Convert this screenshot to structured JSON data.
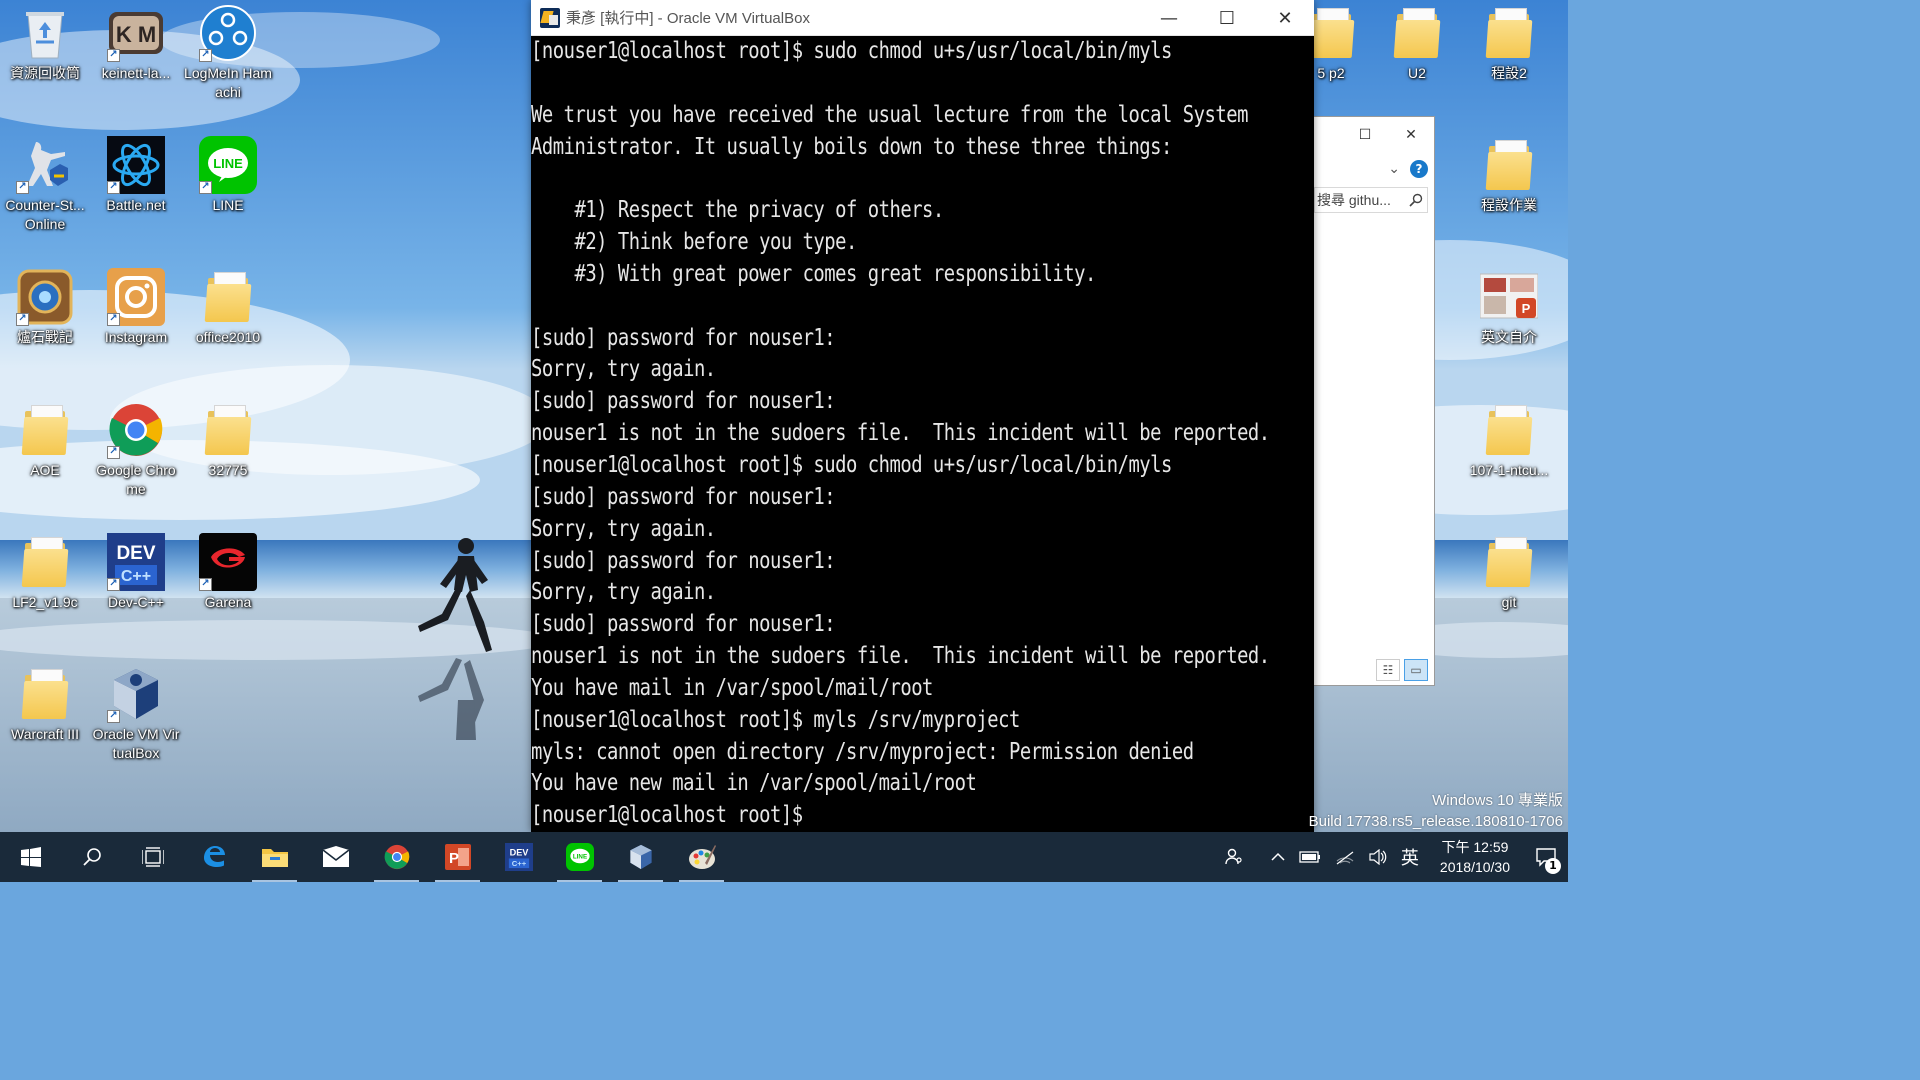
{
  "colors": {
    "terminal_bg": "#000000",
    "terminal_fg": "#e6e6e6",
    "taskbar_bg": "#1a2a3a",
    "sky_top": "#3a7fd0",
    "sea": "#2f6fb4"
  },
  "desktop": {
    "left_icons": [
      {
        "label": "資源回收筒",
        "icon": "recycle-bin-icon"
      },
      {
        "label": "keinett-la...",
        "icon": "keinett-launcher-icon"
      },
      {
        "label": "LogMeIn Hamachi",
        "icon": "hamachi-icon"
      },
      {
        "label": "Counter-St... Online",
        "icon": "counter-strike-icon"
      },
      {
        "label": "Battle.net",
        "icon": "battlenet-icon"
      },
      {
        "label": "LINE",
        "icon": "line-icon"
      },
      {
        "label": "爐石戰記",
        "icon": "hearthstone-icon"
      },
      {
        "label": "Instagram",
        "icon": "instagram-icon"
      },
      {
        "label": "office2010",
        "icon": "folder-icon"
      },
      {
        "label": "AOE",
        "icon": "folder-icon"
      },
      {
        "label": "Google Chrome",
        "icon": "chrome-icon"
      },
      {
        "label": "32775",
        "icon": "folder-icon"
      },
      {
        "label": "LF2_v1.9c",
        "icon": "folder-icon"
      },
      {
        "label": "Dev-C++",
        "icon": "devcpp-icon"
      },
      {
        "label": "Garena",
        "icon": "garena-icon"
      },
      {
        "label": "Warcraft III",
        "icon": "folder-icon"
      },
      {
        "label": "Oracle VM VirtualBox",
        "icon": "virtualbox-icon"
      }
    ],
    "right_icons": [
      {
        "label": "5 p2",
        "icon": "folder-icon"
      },
      {
        "label": "U2",
        "icon": "folder-icon"
      },
      {
        "label": "程設2",
        "icon": "folder-icon"
      },
      {
        "label": "程設作業",
        "icon": "folder-icon"
      },
      {
        "label": "英文自介",
        "icon": "powerpoint-file-icon"
      },
      {
        "label": "107-1-ntcu...",
        "icon": "folder-icon"
      },
      {
        "label": "git",
        "icon": "folder-icon"
      }
    ]
  },
  "explorer": {
    "search_placeholder": "搜尋 githu...",
    "maximize_glyph": "☐",
    "close_glyph": "✕",
    "help_glyph": "?"
  },
  "vbox": {
    "title": "秉彥 [執行中] - Oracle VM VirtualBox",
    "minimize_glyph": "—",
    "maximize_glyph": "☐",
    "close_glyph": "✕",
    "terminal_lines": [
      "[nouser1@localhost root]$ sudo chmod u+s/usr/local/bin/myls",
      "",
      "We trust you have received the usual lecture from the local System",
      "Administrator. It usually boils down to these three things:",
      "",
      "    #1) Respect the privacy of others.",
      "    #2) Think before you type.",
      "    #3) With great power comes great responsibility.",
      "",
      "[sudo] password for nouser1:",
      "Sorry, try again.",
      "[sudo] password for nouser1:",
      "nouser1 is not in the sudoers file.  This incident will be reported.",
      "[nouser1@localhost root]$ sudo chmod u+s/usr/local/bin/myls",
      "[sudo] password for nouser1:",
      "Sorry, try again.",
      "[sudo] password for nouser1:",
      "Sorry, try again.",
      "[sudo] password for nouser1:",
      "nouser1 is not in the sudoers file.  This incident will be reported.",
      "You have mail in /var/spool/mail/root",
      "[nouser1@localhost root]$ myls /srv/myproject",
      "myls: cannot open directory /srv/myproject: Permission denied",
      "You have new mail in /var/spool/mail/root",
      "[nouser1@localhost root]$"
    ]
  },
  "watermark": {
    "line1": "Windows 10 專業版",
    "line2": "Build 17738.rs5_release.180810-1706"
  },
  "taskbar": {
    "apps": [
      {
        "name": "start-button",
        "icon": "windows-logo-icon",
        "running": false
      },
      {
        "name": "search-button",
        "icon": "search-icon",
        "running": false
      },
      {
        "name": "task-view-button",
        "icon": "task-view-icon",
        "running": false
      },
      {
        "name": "taskbar-edge",
        "icon": "edge-icon",
        "running": false
      },
      {
        "name": "taskbar-file-explorer",
        "icon": "file-explorer-icon",
        "running": true
      },
      {
        "name": "taskbar-mail",
        "icon": "mail-icon",
        "running": false
      },
      {
        "name": "taskbar-chrome",
        "icon": "chrome-icon",
        "running": true
      },
      {
        "name": "taskbar-powerpoint",
        "icon": "powerpoint-icon",
        "running": true
      },
      {
        "name": "taskbar-devcpp",
        "icon": "devcpp-icon",
        "running": false
      },
      {
        "name": "taskbar-line",
        "icon": "line-icon",
        "running": true
      },
      {
        "name": "taskbar-virtualbox",
        "icon": "virtualbox-icon",
        "running": true
      },
      {
        "name": "taskbar-paint",
        "icon": "paint-icon",
        "running": true
      }
    ],
    "tray": {
      "ime_label": "英",
      "time": "下午 12:59",
      "date": "2018/10/30",
      "notification_count": "1"
    }
  }
}
